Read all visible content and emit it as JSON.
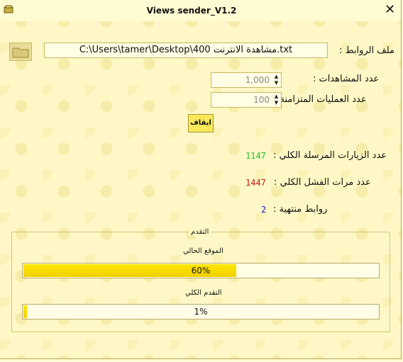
{
  "window": {
    "title": "Views sender_V1.2"
  },
  "links_file": {
    "label": "ملف الروابط :",
    "path": "C:\\Users\\tamer\\Desktop\\400 مشاهدة الانترنت.txt"
  },
  "views": {
    "label": "عدد المشاهدات :",
    "value": "1,000"
  },
  "concurrent": {
    "label": "عدد العمليات المتزامنة :",
    "value": "100"
  },
  "stop_button": {
    "label": "ايقاف"
  },
  "stats": {
    "total_sent": {
      "label": "عدد الزيارات المرسلة الكلي :",
      "value": "1147",
      "color": "#22c02a"
    },
    "total_failed": {
      "label": "عدد مرات الفشل الكلي :",
      "value": "1447",
      "color": "#c01818"
    },
    "finished_links": {
      "label": "روابط منتهية :",
      "value": "2",
      "color": "#1818c8"
    }
  },
  "progress": {
    "group_title": "التقدم",
    "current": {
      "label": "الموقع الحالي",
      "percent": 60,
      "text": "60%"
    },
    "overall": {
      "label": "التقدم الكلي",
      "percent": 1,
      "text": "1%"
    }
  }
}
